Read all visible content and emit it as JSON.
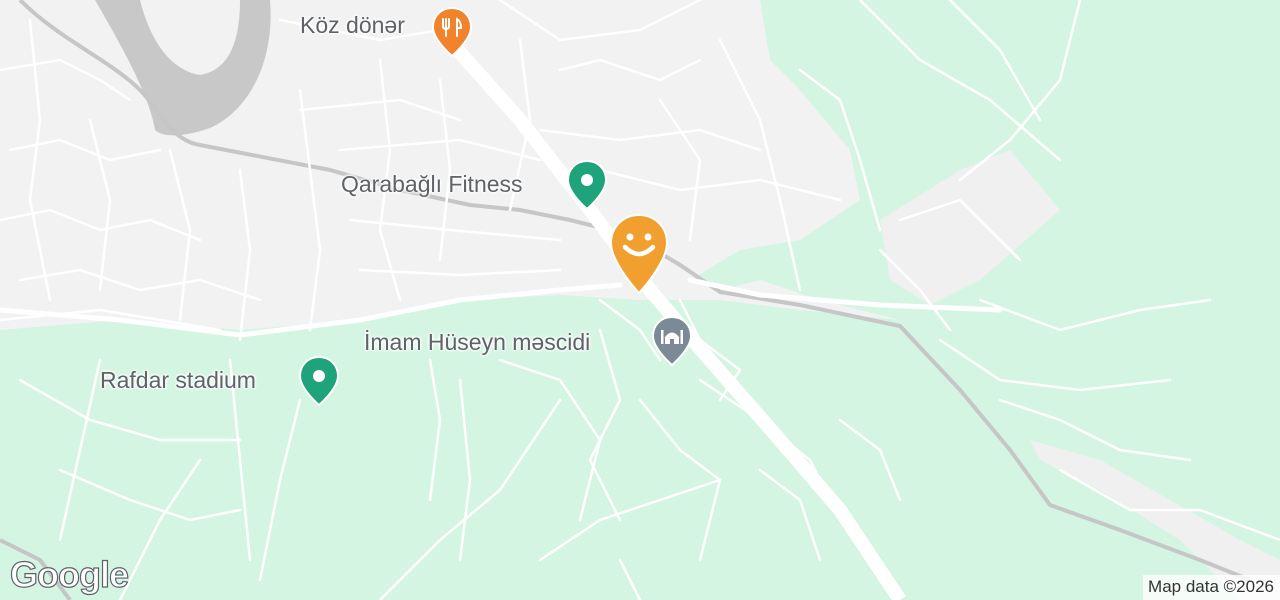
{
  "map": {
    "colors": {
      "land": "#f2f2f2",
      "green": "#d3f5e2",
      "water": "#c8c8c8",
      "road": "#ffffff",
      "rail": "#c0c0c0",
      "poi_green": "#1fa37a",
      "poi_orange": "#f0832c",
      "poi_gray": "#7b8a96",
      "marker": "#f1a030"
    },
    "pois": [
      {
        "name": "Köz dönər",
        "icon": "restaurant-icon"
      },
      {
        "name": "Qarabağlı Fitness",
        "icon": "fitness-icon"
      },
      {
        "name": "İmam Hüseyn məscidi",
        "icon": "mosque-icon"
      },
      {
        "name": "Rafdar stadium",
        "icon": "stadium-icon"
      }
    ],
    "selected_marker_icon": "smiley-marker-icon",
    "attribution": "Map data ©2026",
    "logo": "Google"
  }
}
